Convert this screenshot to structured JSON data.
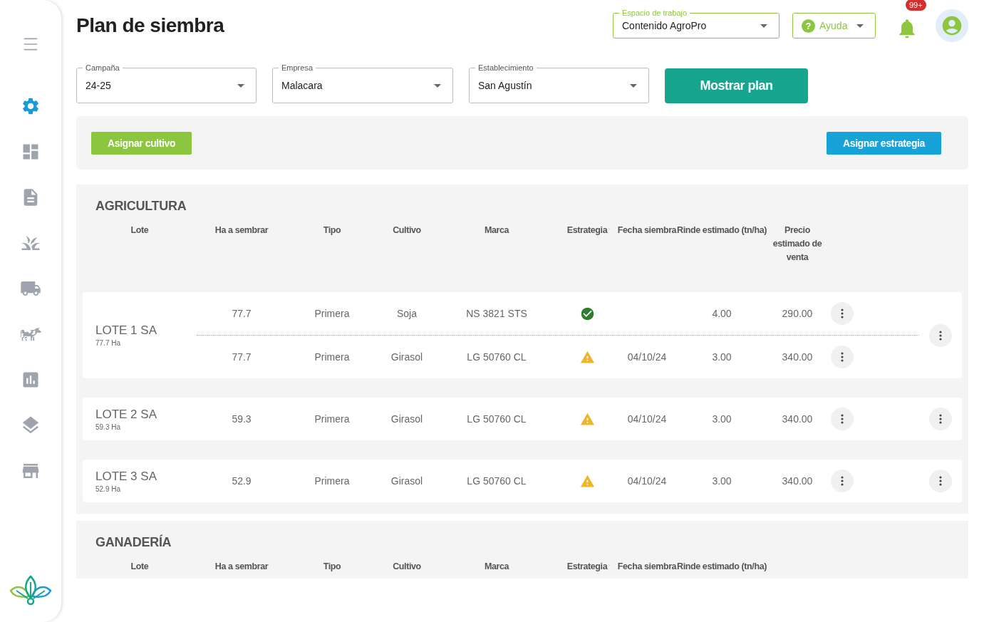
{
  "sidebar": {
    "items": [
      {
        "kind": "menu",
        "selected": false
      },
      {
        "kind": "settings",
        "selected": true
      },
      {
        "kind": "dashboard",
        "selected": false
      },
      {
        "kind": "document",
        "selected": false
      },
      {
        "kind": "grass",
        "selected": false
      },
      {
        "kind": "truck",
        "selected": false
      },
      {
        "kind": "cow",
        "selected": false
      },
      {
        "kind": "chart",
        "selected": false
      },
      {
        "kind": "layers",
        "selected": false
      },
      {
        "kind": "store",
        "selected": false
      }
    ]
  },
  "header": {
    "title": "Plan de siembra",
    "workspace": {
      "label": "Espacio de trabajo",
      "value": "Contenido AgroPro"
    },
    "help": {
      "label": "Ayuda",
      "icon": "?"
    },
    "notifications": {
      "badge": "99+"
    }
  },
  "filters": [
    {
      "label": "Campaña",
      "value": "24-25"
    },
    {
      "label": "Empresa",
      "value": "Malacara"
    },
    {
      "label": "Establecimiento",
      "value": "San Agustín"
    }
  ],
  "show_button": "Mostrar plan",
  "actions": [
    "Asignar cultivo",
    "Asignar estrategia"
  ],
  "sections": [
    {
      "title": "AGRICULTURA",
      "columns": [
        "Lote",
        "Ha a sembrar",
        "Tipo",
        "Cultivo",
        "Marca",
        "Estrategia",
        "Fecha siembra",
        "Rinde estimado (tn/ha)",
        "Precio estimado de venta"
      ],
      "lots": [
        {
          "name": "LOTE 1 SA",
          "area": "77.7 Ha",
          "crops": [
            {
              "ha": "77.7",
              "tipo": "Primera",
              "cultivo": "Soja",
              "marca": "NS 3821 STS",
              "strategy_ok": true,
              "rinde": "4.00",
              "precio": "290.00"
            },
            {
              "ha": "77.7",
              "tipo": "Primera",
              "cultivo": "Girasol",
              "marca": "LG 50760 CL",
              "strategy_ok": false,
              "fecha": "04/10/24",
              "rinde": "3.00",
              "precio": "340.00"
            }
          ]
        },
        {
          "name": "LOTE 2 SA",
          "area": "59.3 Ha",
          "crops": [
            {
              "ha": "59.3",
              "tipo": "Primera",
              "cultivo": "Girasol",
              "marca": "LG 50760 CL",
              "strategy_ok": false,
              "fecha": "04/10/24",
              "rinde": "3.00",
              "precio": "340.00"
            }
          ]
        },
        {
          "name": "LOTE 3 SA",
          "area": "52.9 Ha",
          "crops": [
            {
              "ha": "52.9",
              "tipo": "Primera",
              "cultivo": "Girasol",
              "marca": "LG 50760 CL",
              "strategy_ok": false,
              "fecha": "04/10/24",
              "rinde": "3.00",
              "precio": "340.00"
            }
          ]
        }
      ]
    },
    {
      "title": "GANADERÍA",
      "columns": [
        "Lote",
        "Ha a sembrar",
        "Tipo",
        "Cultivo",
        "Marca",
        "Estrategia",
        "Fecha siembra",
        "Rinde estimado (tn/ha)"
      ]
    }
  ]
}
